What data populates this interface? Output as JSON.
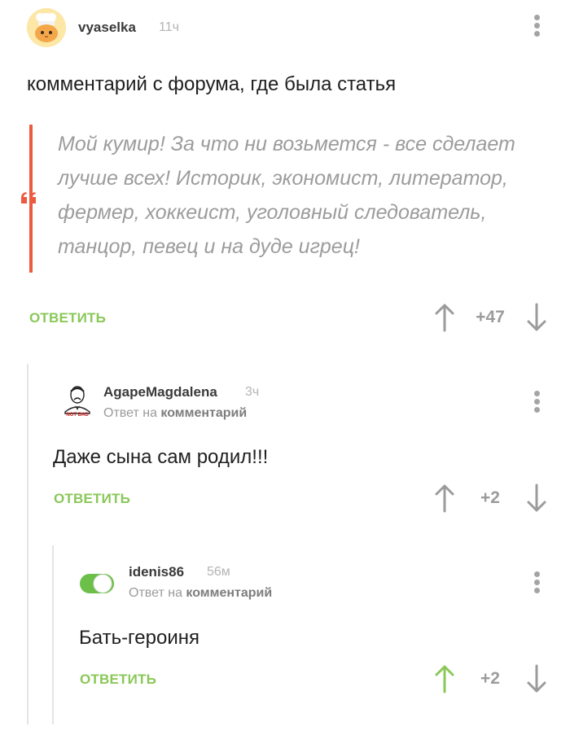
{
  "colors": {
    "accent_green": "#8ac858",
    "quote_red": "#ec5a42",
    "muted_gray": "#9b9b9b"
  },
  "post": {
    "username": "vyaselka",
    "time": "11ч",
    "text": "комментарий с форума, где была статья",
    "quote": "Мой кумир! За что ни возьмется - все сделает лучше всех! Историк, экономист, литератор, фермер, хоккеист, уголовный следователь, танцор, певец и на дуде игрец!",
    "reply_label": "ОТВЕТИТЬ",
    "score": "+47"
  },
  "comment1": {
    "username": "AgapeMagdalena",
    "time": "3ч",
    "reply_to_prefix": "Ответ на",
    "reply_to_target": "комментарий",
    "text": "Даже сына сам родил!!!",
    "reply_label": "ОТВЕТИТЬ",
    "score": "+2",
    "avatar_caption": "NOT BAD"
  },
  "comment2": {
    "username": "idenis86",
    "time": "56м",
    "reply_to_prefix": "Ответ на",
    "reply_to_target": "комментарий",
    "text": "Бать-героиня",
    "reply_label": "ОТВЕТИТЬ",
    "score": "+2",
    "upvoted": true
  },
  "icons": {
    "menu": "more-vertical-icon",
    "upvote": "arrow-up-icon",
    "downvote": "arrow-down-icon",
    "quote": "quote-mark-icon",
    "toggle": "toggle-switch-icon"
  }
}
